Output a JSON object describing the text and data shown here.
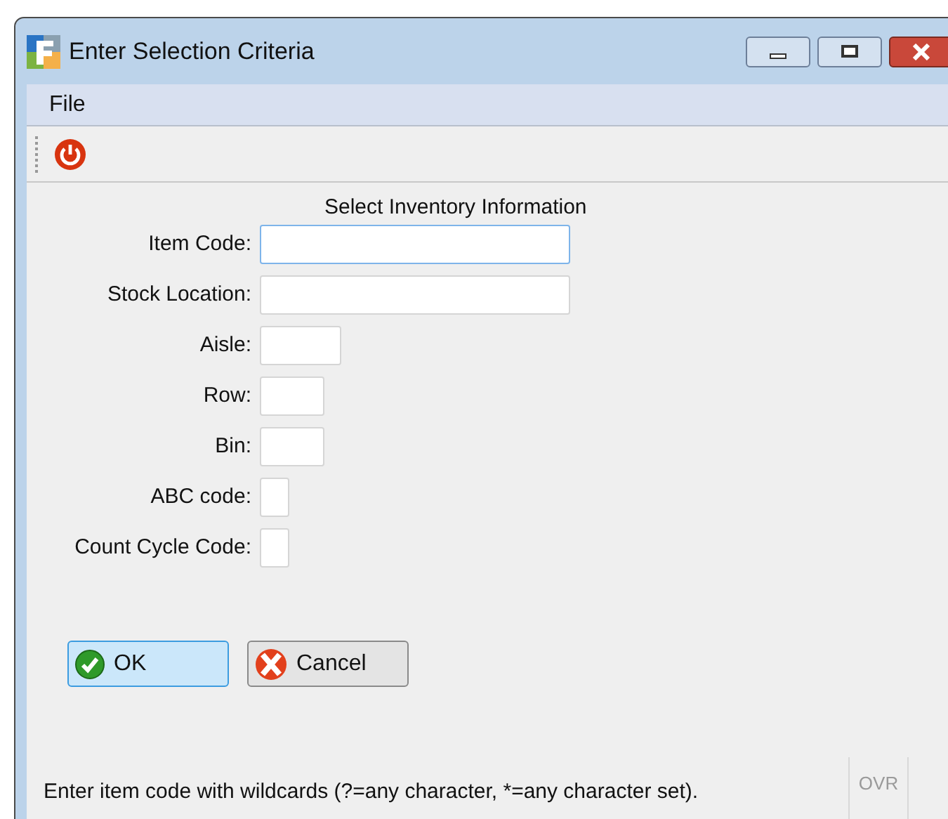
{
  "window": {
    "title": "Enter Selection Criteria"
  },
  "menu": [
    "File"
  ],
  "form": {
    "heading": "Select Inventory Information",
    "fields": [
      {
        "label": "Item Code:",
        "kind": "wide",
        "focused": true
      },
      {
        "label": "Stock Location:",
        "kind": "wide",
        "focused": false
      },
      {
        "label": "Aisle:",
        "kind": "medium",
        "focused": false
      },
      {
        "label": "Row:",
        "kind": "narrow",
        "focused": false
      },
      {
        "label": "Bin:",
        "kind": "narrow",
        "focused": false
      },
      {
        "label": "ABC code:",
        "kind": "tiny",
        "focused": false
      },
      {
        "label": "Count Cycle Code:",
        "kind": "tiny",
        "focused": false
      }
    ]
  },
  "buttons": [
    {
      "label": "OK",
      "kind": "ok",
      "default": true
    },
    {
      "label": "Cancel",
      "kind": "cancel",
      "default": false
    }
  ],
  "status_bar": {
    "message": "Enter item code with wildcards (?=any character, *=any character set).",
    "mode": "OVR"
  }
}
